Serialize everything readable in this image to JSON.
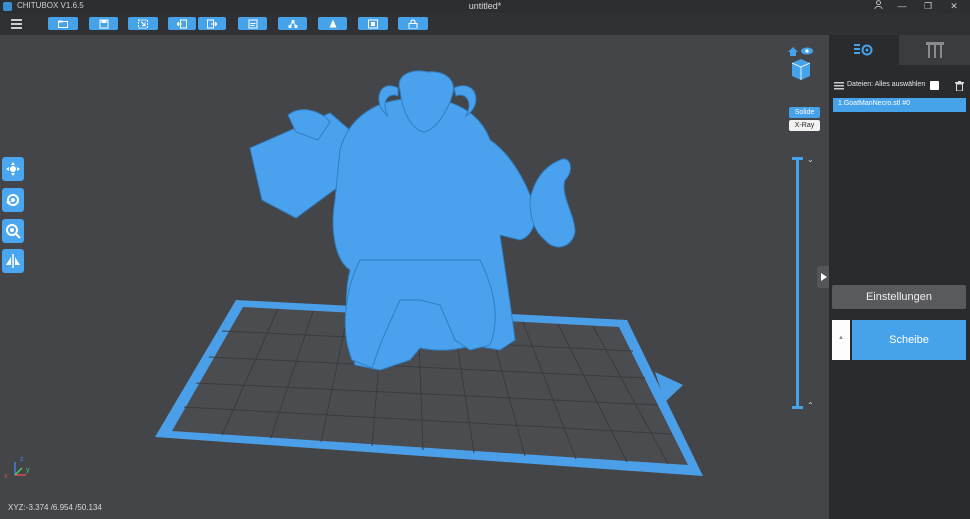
{
  "titlebar": {
    "app_title": "CHITUBOX V1.6.5",
    "doc_title": "untitled*",
    "user_icon": "user-icon",
    "minimize": "—",
    "restore": "❐",
    "close": "✕"
  },
  "toolbar": {
    "buttons": [
      "open-file-icon",
      "save-icon",
      "import-icon",
      "undo-icon",
      "redo-icon",
      "settings-file-icon",
      "network-icon",
      "support-icon",
      "hollow-icon",
      "lock-icon"
    ]
  },
  "viewport": {
    "coords": "XYZ:-3.374 /6.954 /50.134",
    "render_modes": {
      "solid": "Solide",
      "xray": "X-Ray"
    },
    "left_tools": [
      "move-icon",
      "rotate-icon",
      "scale-icon",
      "mirror-icon"
    ],
    "axes": {
      "x": "x",
      "y": "y",
      "z": "z"
    },
    "colors": {
      "model": "#4aa2ee",
      "plate": "#4a9fe8",
      "grid": "#3a3b3e"
    }
  },
  "panel": {
    "files_label": "Dateien:  Alles auswählen",
    "file_items": [
      "1.GoatManNecro.stl #0"
    ],
    "settings_label": "Einstellungen",
    "slice_label": "Scheibe"
  },
  "colors": {
    "accent": "#46a3ea",
    "background": "#444548",
    "panel": "#2a2b2e"
  }
}
